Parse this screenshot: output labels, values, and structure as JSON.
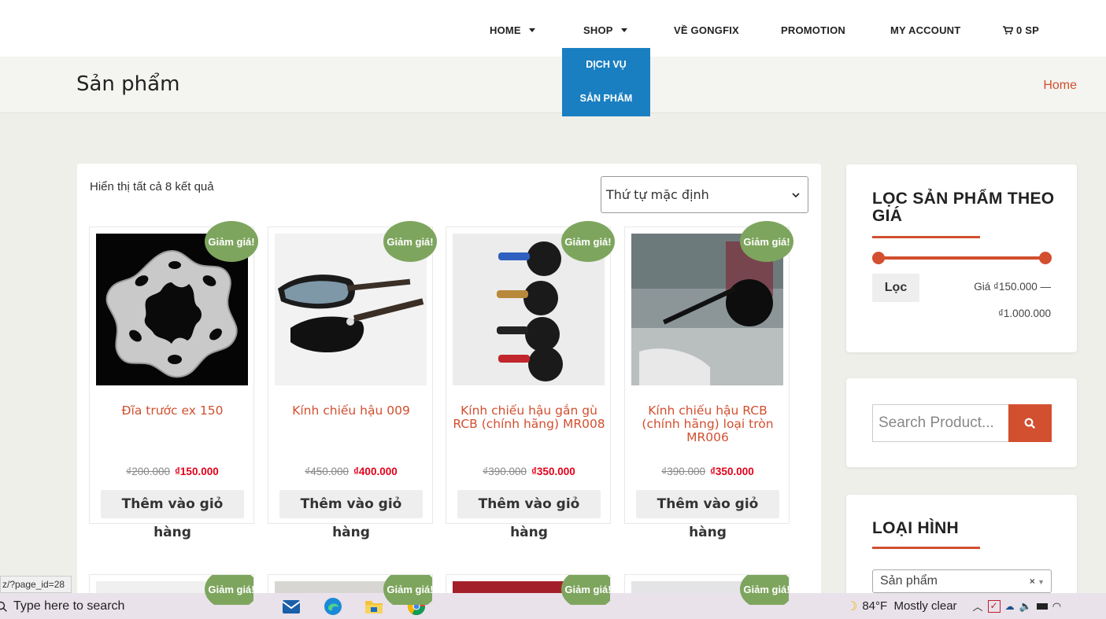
{
  "nav": {
    "items": [
      {
        "label": "HOME",
        "has_caret": true
      },
      {
        "label": "SHOP",
        "has_caret": true
      },
      {
        "label": "VỀ GONGFIX",
        "has_caret": false
      },
      {
        "label": "PROMOTION",
        "has_caret": false
      },
      {
        "label": "MY ACCOUNT",
        "has_caret": false
      }
    ],
    "cart_label": "0 SP",
    "shop_dropdown": [
      "DỊCH VỤ",
      "SẢN PHẨM"
    ]
  },
  "header": {
    "page_title": "Sản phẩm",
    "breadcrumb": "Home"
  },
  "shop": {
    "result_count": "Hiển thị tất cả 8 kết quả",
    "sort_selected": "Thứ tự mặc định",
    "sale_badge": "Giảm giá!",
    "add_to_cart": "Thêm vào giỏ hàng",
    "products": [
      {
        "name": "Đĩa trước ex 150",
        "old_price": "₫200.000",
        "new_price": "₫150.000"
      },
      {
        "name": "Kính chiếu hậu 009",
        "old_price": "₫450.000",
        "new_price": "₫400.000"
      },
      {
        "name": "Kính chiếu hậu gắn gù RCB (chính hãng) MR008",
        "old_price": "₫390.000",
        "new_price": "₫350.000"
      },
      {
        "name": "Kính chiếu hậu RCB (chính hãng) loại tròn MR006",
        "old_price": "₫390.000",
        "new_price": "₫350.000"
      }
    ]
  },
  "sidebar": {
    "price_filter": {
      "title": "LỌC SẢN PHẨM THEO GIÁ",
      "filter_button": "Lọc",
      "range_line1": "Giá ₫150.000 —",
      "range_line2": "₫1.000.000"
    },
    "search": {
      "placeholder": "Search Product..."
    },
    "category": {
      "title": "LOẠI HÌNH",
      "selected": "Sản phẩm",
      "clear": "×"
    }
  },
  "status_url": "z/?page_id=28",
  "taskbar": {
    "search_placeholder": "Type here to search",
    "weather": "84°F  Mostly clear"
  },
  "colors": {
    "accent": "#d24f2f",
    "dropdown": "#1a7fc1",
    "sale_badge": "#7ea55e",
    "sale_price": "#e2001a"
  }
}
